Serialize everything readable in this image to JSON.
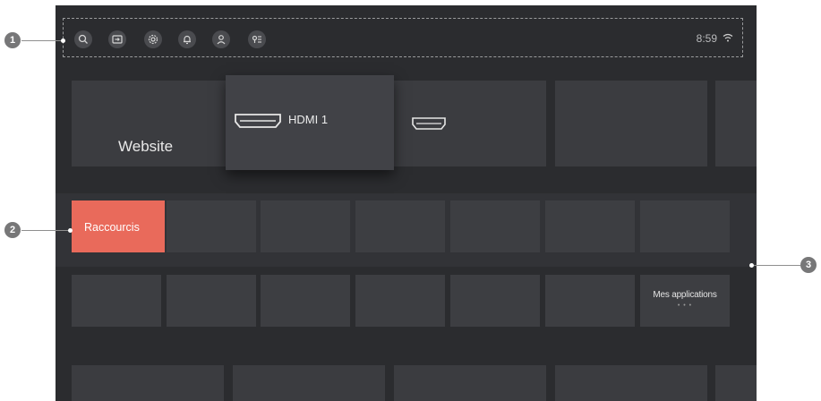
{
  "topbar": {
    "icons": [
      "search-icon",
      "input-source-icon",
      "settings-icon",
      "notifications-icon",
      "account-icon",
      "assistant-icon"
    ],
    "time": "8:59"
  },
  "row1": {
    "website_label": "Website",
    "hdmi1_label": "HDMI 1"
  },
  "shortcuts": {
    "raccourcis_label": "Raccourcis"
  },
  "apps": {
    "mes_applications_label": "Mes applications",
    "more_dots": "• • •"
  },
  "callouts": [
    "1",
    "2",
    "3"
  ],
  "colors": {
    "background": "#2b2c2f",
    "tile": "#3b3c40",
    "accent": "#e96a5b",
    "page": "#ffffff"
  }
}
